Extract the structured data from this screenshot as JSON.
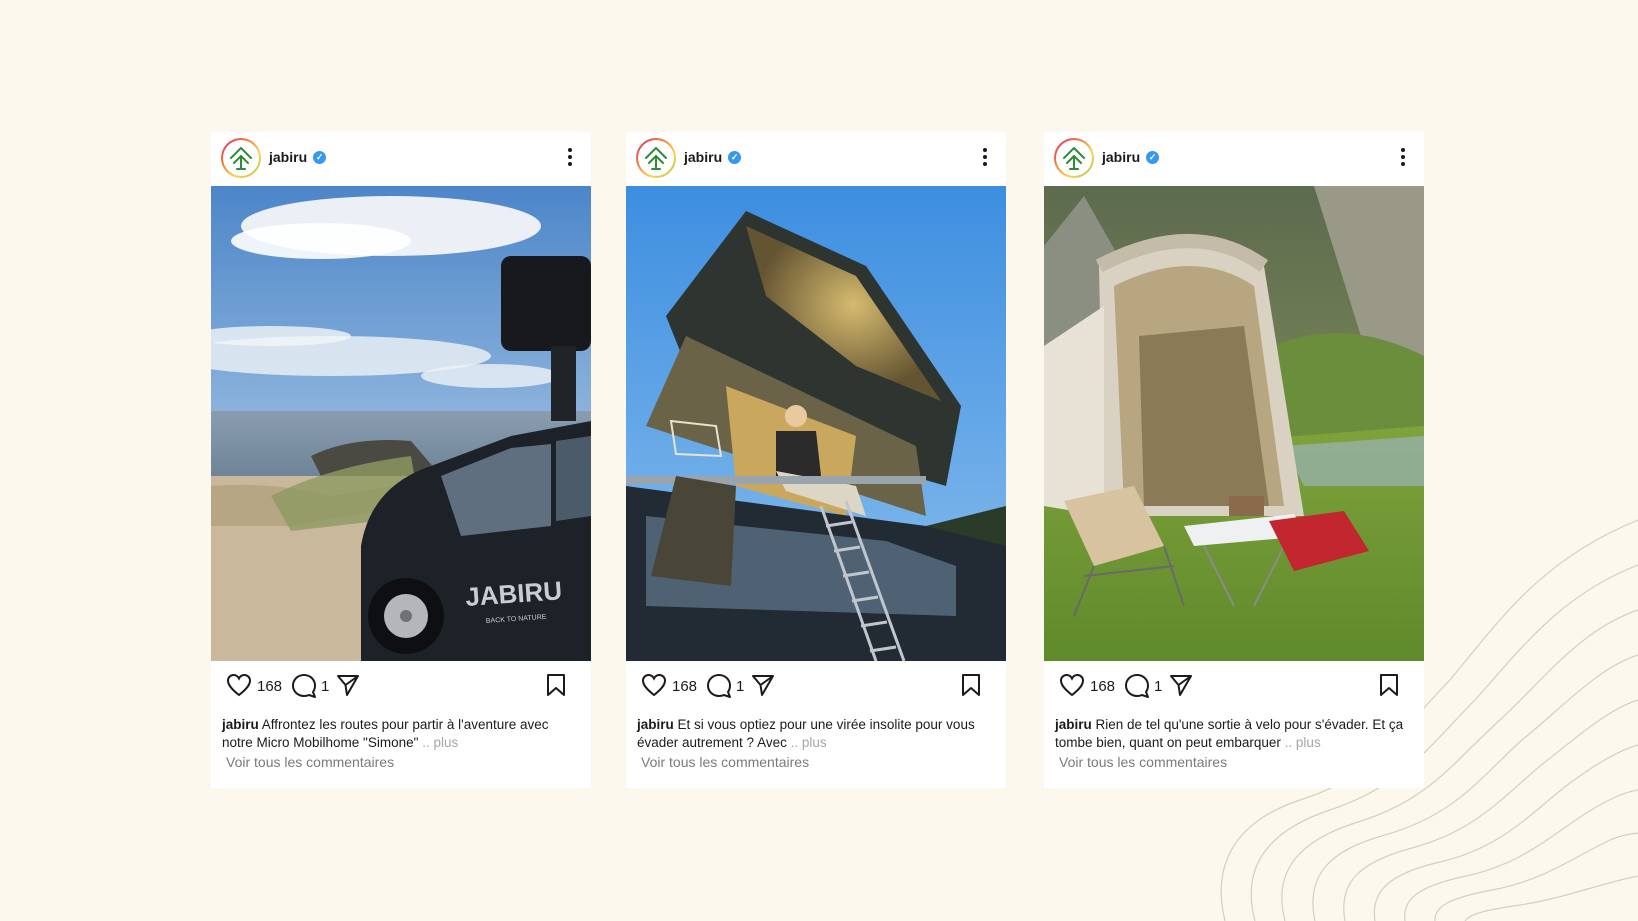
{
  "posts": [
    {
      "username": "jabiru",
      "likes": "168",
      "comments": "1",
      "caption_user": "jabiru",
      "caption_text": "Affrontez les routes pour partir à l'aventure avec notre Micro Mobilhome \"Simone\"",
      "more_label": ".. plus",
      "view_comments": "Voir tous les commentaires"
    },
    {
      "username": "jabiru",
      "likes": "168",
      "comments": "1",
      "caption_user": "jabiru",
      "caption_text": "Et si vous optiez pour une virée insolite pour vous évader autrement ? Avec",
      "more_label": ".. plus",
      "view_comments": "Voir tous les commentaires"
    },
    {
      "username": "jabiru",
      "likes": "168",
      "comments": "1",
      "caption_user": "jabiru",
      "caption_text": "Rien de tel qu'une sortie à velo pour s'évader. Et ça tombe bien, quant on peut embarquer",
      "more_label": " .. plus",
      "view_comments": "Voir tous les commentaires"
    }
  ],
  "van_brand": "JABIRU",
  "van_tagline": "BACK TO NATURE",
  "icons": {
    "like": "heart-icon",
    "comment": "comment-bubble-icon",
    "share": "paper-plane-icon",
    "save": "bookmark-icon",
    "menu": "more-vertical-icon",
    "verified": "verified-badge-icon",
    "avatar": "jabiru-tree-logo"
  },
  "colors": {
    "background": "#fcf8ee",
    "verified": "#3897f0",
    "logo_green": "#2e8b3a",
    "muted_text": "#7a7a7a",
    "more_text": "#a5a5a5"
  }
}
